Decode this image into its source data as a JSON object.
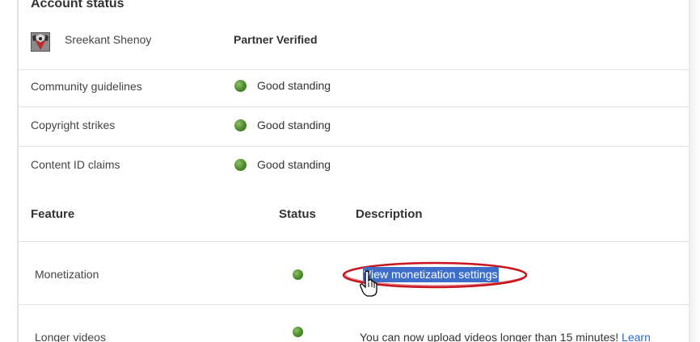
{
  "account": {
    "section_title": "Account status",
    "user_name": "Sreekant Shenoy",
    "partner_status": "Partner Verified",
    "rows": [
      {
        "label": "Community guidelines",
        "status": "Good standing"
      },
      {
        "label": "Copyright strikes",
        "status": "Good standing"
      },
      {
        "label": "Content ID claims",
        "status": "Good standing"
      }
    ]
  },
  "features": {
    "headers": {
      "feature": "Feature",
      "status": "Status",
      "description": "Description"
    },
    "rows": [
      {
        "name": "Monetization",
        "status_icon": "green-dot-icon",
        "description_link": "View monetization settings"
      },
      {
        "name": "Longer videos",
        "status_icon": "green-dot-icon",
        "description_text": "You can now upload videos longer than 15 minutes!",
        "description_link": "Learn"
      }
    ]
  },
  "colors": {
    "status_good": "#4b8a2c",
    "link": "#2f6bc9",
    "highlight": "#3d6ec9",
    "annotation_oval": "#c8141e"
  }
}
